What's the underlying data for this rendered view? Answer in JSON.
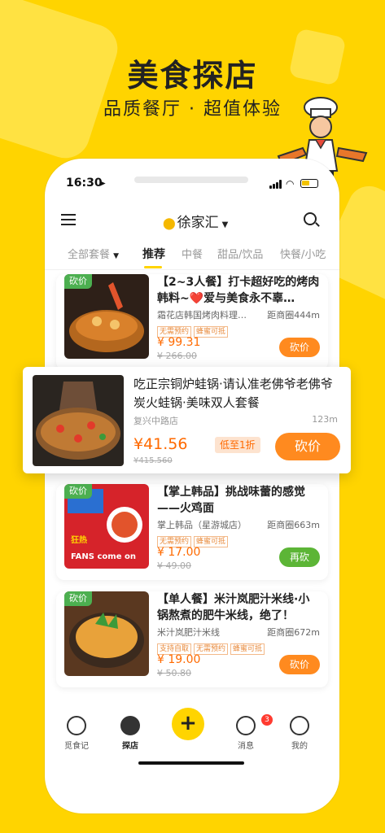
{
  "promo": {
    "headline": "美食探店",
    "subline": "品质餐厅 · 超值体验"
  },
  "status_bar": {
    "time": "16:30"
  },
  "navbar": {
    "city": "徐家汇"
  },
  "tabs": [
    {
      "label": "全部套餐"
    },
    {
      "label": "推荐"
    },
    {
      "label": "中餐"
    },
    {
      "label": "甜品/饮品"
    },
    {
      "label": "快餐/小吃"
    }
  ],
  "featured": {
    "title": "吃正宗铜炉蛙锅·请认准老佛爷老佛爷炭火蛙锅·美味双人套餐",
    "shop": "复兴中路店",
    "distance": "123m",
    "price": "¥41.56",
    "discount": "低至1折",
    "original": "¥415.560",
    "button": "砍价"
  },
  "cards": [
    {
      "badge": "砍价",
      "title": "【2~3人餐】打卡超好吃的烤肉韩料~❤️爱与美食永不辜…",
      "shop": "霜花店韩国烤肉料理…",
      "distance": "距商圈444m",
      "tags": [
        "无需预约",
        "蜂蜜可抵"
      ],
      "price": "¥ 99.31",
      "original": "¥ 266.00",
      "button": "砍价",
      "button_color": "orange"
    },
    {
      "badge": "砍价",
      "title": "【掌上韩品】挑战味蕾的感觉——火鸡面",
      "shop": "掌上韩品（星游城店）",
      "distance": "距商圈663m",
      "tags": [
        "无需预约",
        "蜂蜜可抵"
      ],
      "price": "¥ 17.00",
      "original": "¥ 49.00",
      "button": "再砍",
      "button_color": "green",
      "image_text": [
        "FANS come on",
        "狂热"
      ]
    },
    {
      "badge": "砍价",
      "title": "【单人餐】米汁岚肥汁米线·小锅熬煮的肥牛米线，绝了！",
      "shop": "米汁岚肥汁米线",
      "distance": "距商圈672m",
      "tags": [
        "支持自取",
        "无需预约",
        "蜂蜜可抵"
      ],
      "price": "¥ 19.00",
      "original": "¥ 50.80",
      "button": "砍价",
      "button_color": "orange"
    }
  ],
  "bottom_nav": [
    {
      "label": "觅食记"
    },
    {
      "label": "探店"
    },
    {
      "label": "消息",
      "badge": "3"
    },
    {
      "label": "我的"
    }
  ]
}
